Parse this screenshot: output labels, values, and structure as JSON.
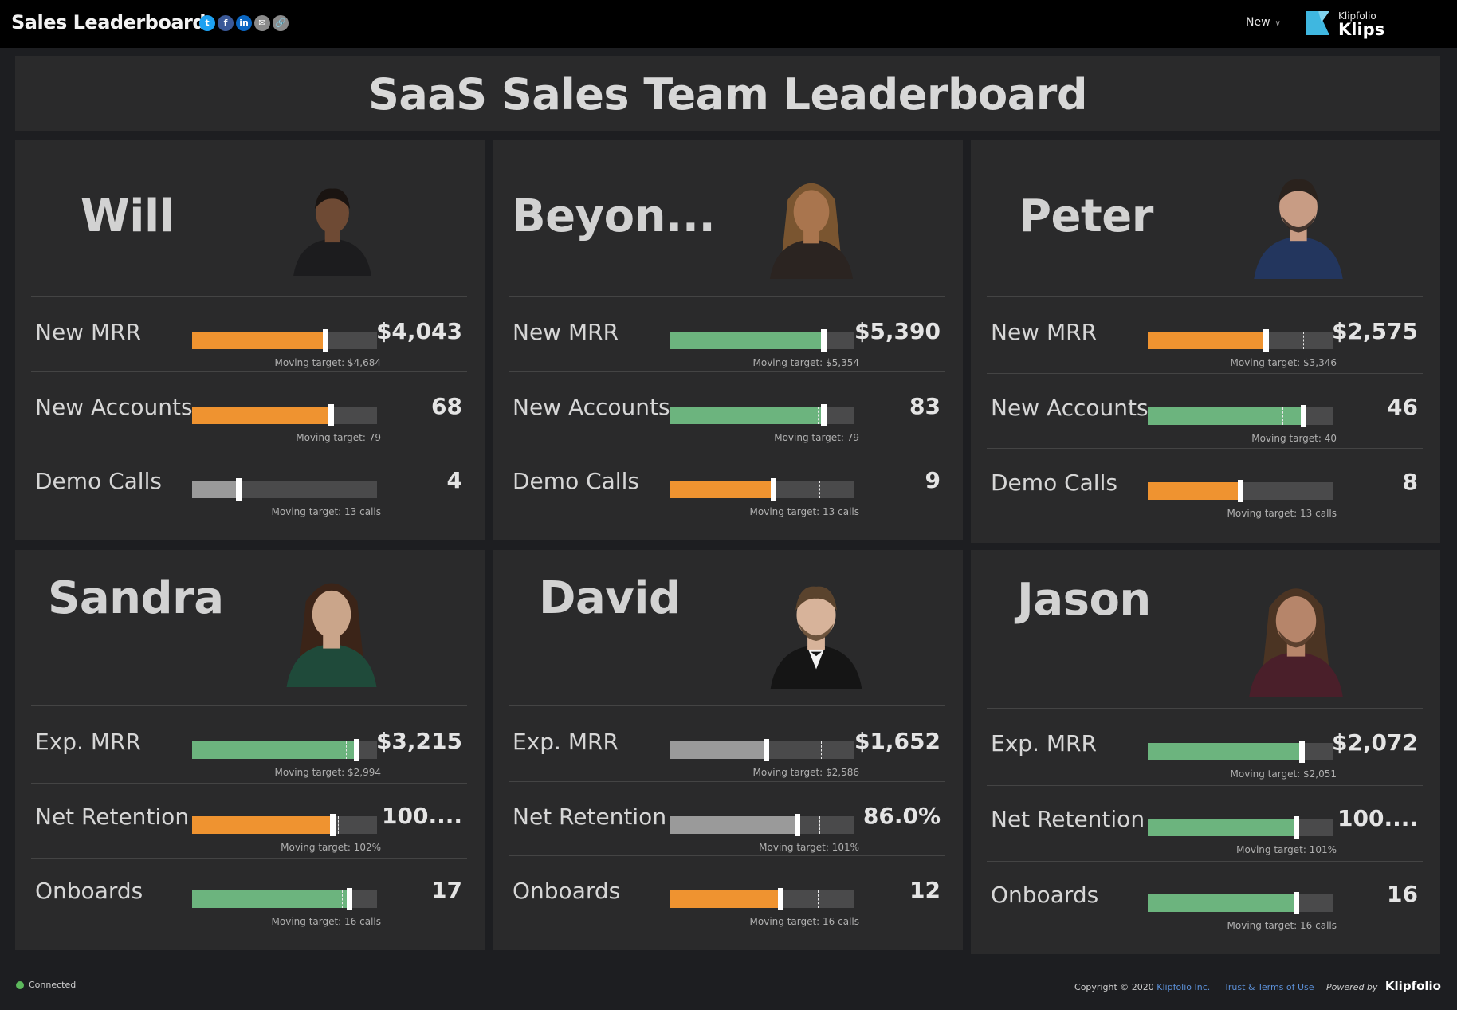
{
  "app": {
    "title": "Sales Leaderboard",
    "share_icons": [
      {
        "name": "twitter-icon",
        "glyph": "t",
        "color": "#1da1f2"
      },
      {
        "name": "facebook-icon",
        "glyph": "f",
        "color": "#3b5998"
      },
      {
        "name": "linkedin-icon",
        "glyph": "in",
        "color": "#0a66c2"
      },
      {
        "name": "email-icon",
        "glyph": "✉",
        "color": "#8a8a8a"
      },
      {
        "name": "link-icon",
        "glyph": "🔗",
        "color": "#8a8a8a"
      }
    ],
    "new_menu": "New",
    "logo_small": "Klipfolio",
    "logo_big": "Klips"
  },
  "banner": {
    "title": "SaaS Sales Team Leaderboard"
  },
  "colors": {
    "orange": "#ef9330",
    "green": "#6cb47e",
    "gray": "#9a9a9a"
  },
  "cards": [
    {
      "name": "Will",
      "photo": "photo-will",
      "metrics": [
        {
          "label": "New MRR",
          "value": "$4,043",
          "target": "Moving target: $4,684",
          "progress": 0.72,
          "target_pos": 0.84,
          "color": "orange"
        },
        {
          "label": "New Accounts",
          "value": "68",
          "target": "Moving target: 79",
          "progress": 0.75,
          "target_pos": 0.88,
          "color": "orange"
        },
        {
          "label": "Demo Calls",
          "value": "4",
          "target": "Moving target: 13 calls",
          "progress": 0.25,
          "target_pos": 0.82,
          "color": "gray"
        }
      ]
    },
    {
      "name": "Beyon...",
      "photo": "photo-beyonce",
      "metrics": [
        {
          "label": "New MRR",
          "value": "$5,390",
          "target": "Moving target: $5,354",
          "progress": 0.83,
          "target_pos": 0.82,
          "color": "green"
        },
        {
          "label": "New Accounts",
          "value": "83",
          "target": "Moving target: 79",
          "progress": 0.83,
          "target_pos": 0.8,
          "color": "green"
        },
        {
          "label": "Demo Calls",
          "value": "9",
          "target": "Moving target: 13 calls",
          "progress": 0.56,
          "target_pos": 0.81,
          "color": "orange"
        }
      ]
    },
    {
      "name": "Peter",
      "photo": "photo-peter",
      "metrics": [
        {
          "label": "New MRR",
          "value": "$2,575",
          "target": "Moving target: $3,346",
          "progress": 0.64,
          "target_pos": 0.84,
          "color": "orange"
        },
        {
          "label": "New Accounts",
          "value": "46",
          "target": "Moving target: 40",
          "progress": 0.84,
          "target_pos": 0.73,
          "color": "green"
        },
        {
          "label": "Demo Calls",
          "value": "8",
          "target": "Moving target: 13 calls",
          "progress": 0.5,
          "target_pos": 0.81,
          "color": "orange"
        }
      ]
    },
    {
      "name": "Sandra",
      "photo": "photo-sandra",
      "metrics": [
        {
          "label": "Exp. MRR",
          "value": "$3,215",
          "target": "Moving target: $2,994",
          "progress": 0.89,
          "target_pos": 0.83,
          "color": "green"
        },
        {
          "label": "Net Retention",
          "value": "100....",
          "target": "Moving target: 102%",
          "progress": 0.76,
          "target_pos": 0.79,
          "color": "orange"
        },
        {
          "label": "Onboards",
          "value": "17",
          "target": "Moving target: 16 calls",
          "progress": 0.85,
          "target_pos": 0.81,
          "color": "green"
        }
      ]
    },
    {
      "name": "David",
      "photo": "photo-david",
      "metrics": [
        {
          "label": "Exp. MRR",
          "value": "$1,652",
          "target": "Moving target: $2,586",
          "progress": 0.52,
          "target_pos": 0.82,
          "color": "gray"
        },
        {
          "label": "Net Retention",
          "value": "86.0%",
          "target": "Moving target: 101%",
          "progress": 0.69,
          "target_pos": 0.81,
          "color": "gray"
        },
        {
          "label": "Onboards",
          "value": "12",
          "target": "Moving target: 16 calls",
          "progress": 0.6,
          "target_pos": 0.8,
          "color": "orange"
        }
      ]
    },
    {
      "name": "Jason",
      "photo": "photo-jason",
      "metrics": [
        {
          "label": "Exp. MRR",
          "value": "$2,072",
          "target": "Moving target: $2,051",
          "progress": 0.83,
          "target_pos": 0.82,
          "color": "green"
        },
        {
          "label": "Net Retention",
          "value": "100....",
          "target": "Moving target: 101%",
          "progress": 0.8,
          "target_pos": 0.79,
          "color": "green"
        },
        {
          "label": "Onboards",
          "value": "16",
          "target": "Moving target: 16 calls",
          "progress": 0.8,
          "target_pos": 0.8,
          "color": "green"
        }
      ]
    }
  ],
  "footer": {
    "status": "Connected",
    "copyright": "Copyright © 2020",
    "company": "Klipfolio Inc.",
    "terms": "Trust & Terms of Use",
    "powered": "Powered by",
    "brand": "Klipfolio"
  }
}
